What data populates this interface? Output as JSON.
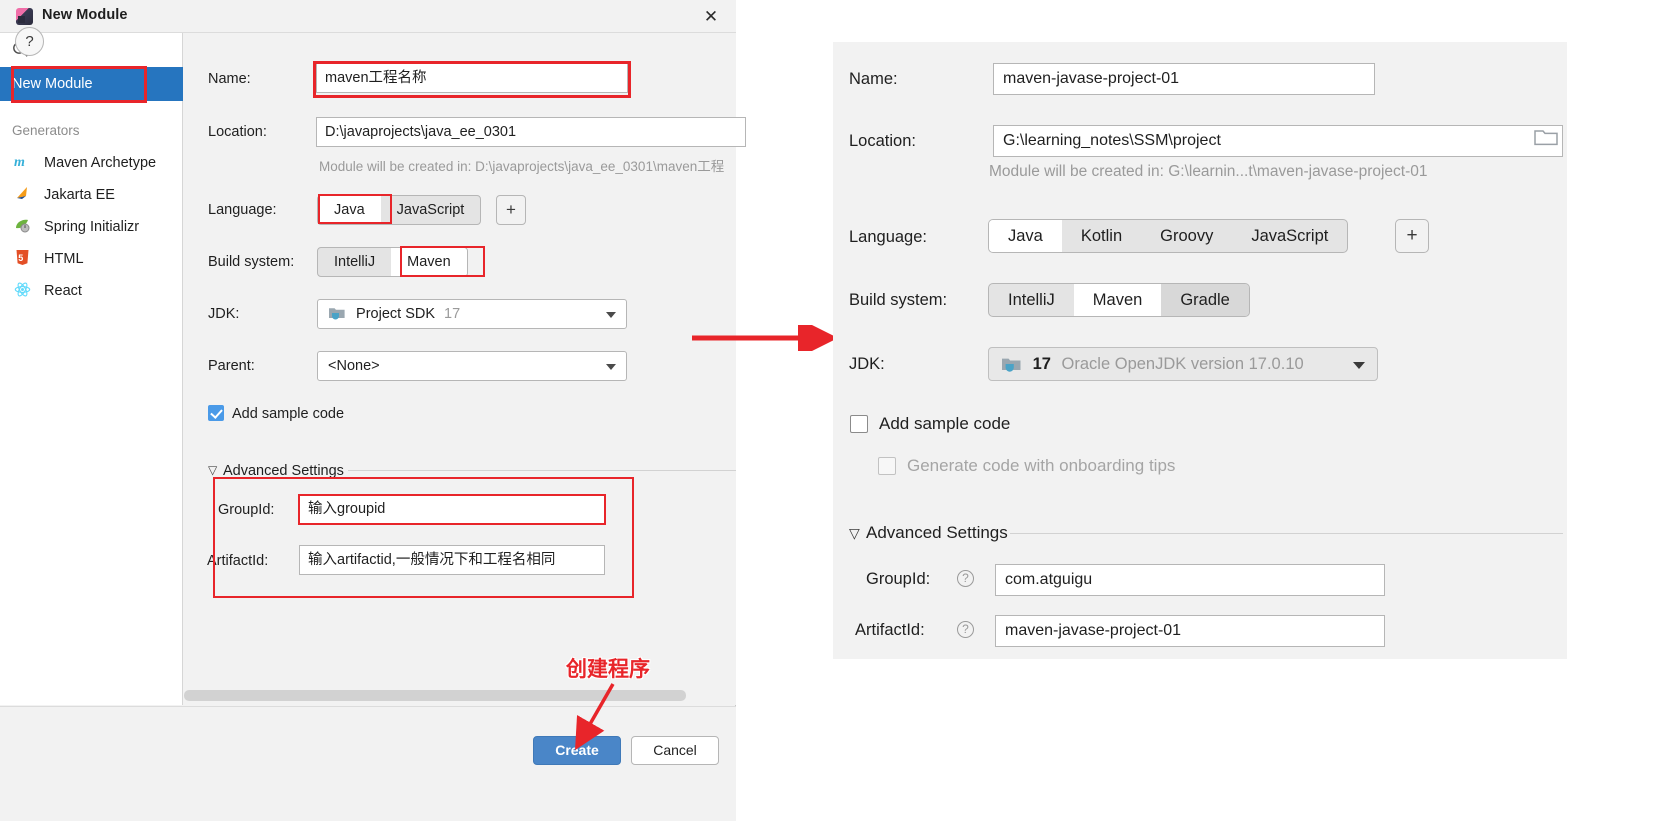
{
  "dialog": {
    "title": "New Module",
    "app_icon": "intellij-idea-icon",
    "close_label": "✕",
    "sidebar": {
      "search_placeholder": "",
      "selected_item": "New Module",
      "group_label": "Generators",
      "items": [
        {
          "label": "Maven Archetype",
          "icon": "maven-icon"
        },
        {
          "label": "Jakarta EE",
          "icon": "jakarta-ee-icon"
        },
        {
          "label": "Spring Initializr",
          "icon": "spring-icon"
        },
        {
          "label": "HTML",
          "icon": "html5-icon"
        },
        {
          "label": "React",
          "icon": "react-icon"
        }
      ]
    },
    "form": {
      "name_label": "Name:",
      "name_value": "maven工程名称",
      "location_label": "Location:",
      "location_value": "D:\\javaprojects\\java_ee_0301",
      "location_hint": "Module will be created in: D:\\javaprojects\\java_ee_0301\\maven工程",
      "language_label": "Language:",
      "language_options": [
        "Java",
        "JavaScript"
      ],
      "language_selected": "Java",
      "add_language_label": "+",
      "build_label": "Build system:",
      "build_options": [
        "IntelliJ",
        "Maven"
      ],
      "build_selected": "Maven",
      "jdk_label": "JDK:",
      "jdk_value": "Project SDK",
      "jdk_version": "17",
      "parent_label": "Parent:",
      "parent_value": "<None>",
      "sample_code_label": "Add sample code",
      "sample_code_checked": true,
      "advanced_label": "Advanced Settings",
      "groupid_label": "GroupId:",
      "groupid_value": "输入groupid",
      "artifactid_label": "ArtifactId:",
      "artifactid_value": "输入artifactid,一般情况下和工程名相同"
    },
    "footer": {
      "help_label": "?",
      "create_label": "Create",
      "cancel_label": "Cancel"
    },
    "annotation": {
      "create_note": "创建程序",
      "color": "#e8252a"
    }
  },
  "right_panel": {
    "name_label": "Name:",
    "name_value": "maven-javase-project-01",
    "location_label": "Location:",
    "location_value": "G:\\learning_notes\\SSM\\project",
    "location_hint": "Module will be created in: G:\\learnin...t\\maven-javase-project-01",
    "browse_icon": "folder-icon",
    "language_label": "Language:",
    "language_options": [
      "Java",
      "Kotlin",
      "Groovy",
      "JavaScript"
    ],
    "language_selected": "Java",
    "add_language_label": "+",
    "build_label": "Build system:",
    "build_options": [
      "IntelliJ",
      "Maven",
      "Gradle"
    ],
    "build_selected": "Maven",
    "build_hovered": "Gradle",
    "jdk_label": "JDK:",
    "jdk_version": "17",
    "jdk_value": "Oracle OpenJDK version 17.0.10",
    "sample_code_label": "Add sample code",
    "sample_code_checked": false,
    "onboarding_label": "Generate code with onboarding tips",
    "onboarding_checked": false,
    "advanced_label": "Advanced Settings",
    "groupid_label": "GroupId:",
    "groupid_value": "com.atguigu",
    "artifactid_label": "ArtifactId:",
    "artifactid_value": "maven-javase-project-01",
    "help_icon": "question-mark-icon"
  }
}
